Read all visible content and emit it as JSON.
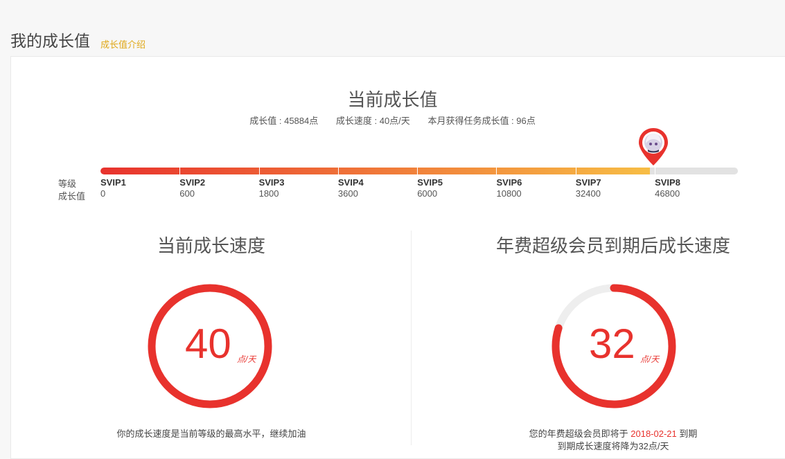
{
  "page": {
    "title": "我的成长值",
    "intro_link": "成长值介绍"
  },
  "growth": {
    "heading": "当前成长值",
    "stats": [
      "成长值 : 45884点",
      "成长速度 : 40点/天",
      "本月获得任务成长值 : 96点"
    ],
    "side_label_1": "等级",
    "side_label_2": "成长值",
    "current_value": 45884,
    "levels": [
      {
        "name": "SVIP1",
        "value": "0"
      },
      {
        "name": "SVIP2",
        "value": "600"
      },
      {
        "name": "SVIP3",
        "value": "1800"
      },
      {
        "name": "SVIP4",
        "value": "3600"
      },
      {
        "name": "SVIP5",
        "value": "6000"
      },
      {
        "name": "SVIP6",
        "value": "10800"
      },
      {
        "name": "SVIP7",
        "value": "32400"
      },
      {
        "name": "SVIP8",
        "value": "46800"
      }
    ],
    "bar_fill_colors": [
      "#e8322d",
      "#f7bd45"
    ],
    "avatar_icon": "avatar-pin-icon"
  },
  "current_speed": {
    "title": "当前成长速度",
    "value": "40",
    "unit": "点/天",
    "gauge_fraction": 1.0,
    "note": "你的成长速度是当前等级的最高水平，继续加油"
  },
  "after_expiry_speed": {
    "title": "年费超级会员到期后成长速度",
    "value": "32",
    "unit": "点/天",
    "gauge_fraction": 0.8,
    "note_prefix": "您的年费超级会员即将于",
    "note_date": "2018-02-21",
    "note_suffix": "到期",
    "note_line2": "到期成长速度将降为32点/天"
  },
  "colors": {
    "accent": "#e8322d",
    "link": "#e0a91b",
    "track": "#e2e2e2"
  }
}
